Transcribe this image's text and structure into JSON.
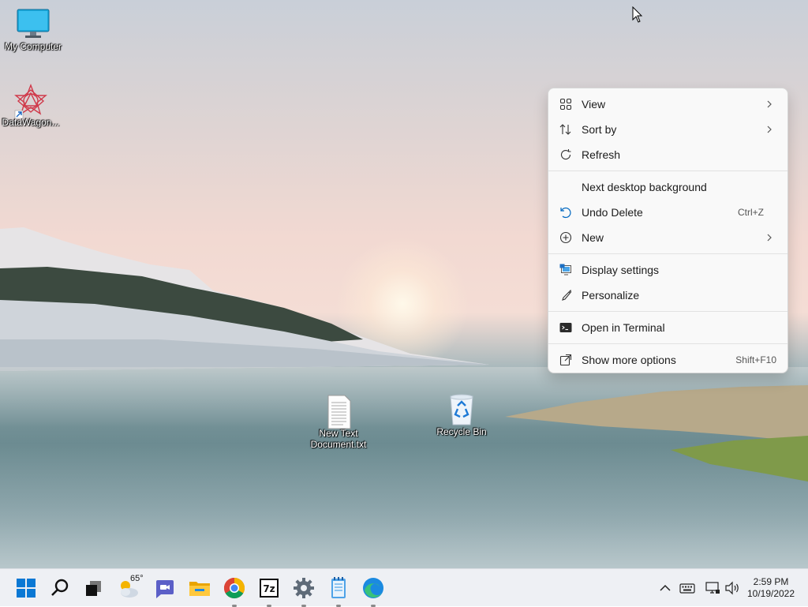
{
  "desktop": {
    "icons": [
      {
        "label": "My Computer"
      },
      {
        "label": "DataWagon..."
      },
      {
        "label": "New Text Document.txt"
      },
      {
        "label": "Recycle Bin"
      }
    ]
  },
  "context_menu": {
    "items": [
      {
        "label": "View",
        "icon": "grid-icon",
        "submenu": true
      },
      {
        "label": "Sort by",
        "icon": "sort-icon",
        "submenu": true
      },
      {
        "label": "Refresh",
        "icon": "refresh-icon"
      },
      {
        "label": "Next desktop background"
      },
      {
        "label": "Undo Delete",
        "icon": "undo-icon",
        "shortcut": "Ctrl+Z"
      },
      {
        "label": "New",
        "icon": "plus-circle-icon",
        "submenu": true
      },
      {
        "label": "Display settings",
        "icon": "display-icon"
      },
      {
        "label": "Personalize",
        "icon": "brush-icon"
      },
      {
        "label": "Open in Terminal",
        "icon": "terminal-icon"
      },
      {
        "label": "Show more options",
        "icon": "more-options-icon",
        "shortcut": "Shift+F10"
      }
    ]
  },
  "taskbar": {
    "weather_temp": "65°",
    "apps": [
      "start-icon",
      "search-icon",
      "task-view-icon",
      "weather-icon",
      "teams-chat-icon",
      "file-explorer-icon",
      "chrome-icon",
      "7zip-icon",
      "settings-icon",
      "notepad-icon",
      "edge-icon"
    ],
    "tray": [
      "chevron-up-icon",
      "keyboard-icon",
      "network-icon",
      "volume-icon"
    ],
    "clock": {
      "time": "2:59 PM",
      "date": "10/19/2022"
    }
  },
  "colors": {
    "accent": "#0067c0",
    "menu_bg": "#f9f9f9",
    "taskbar_bg": "#eef0f4"
  }
}
